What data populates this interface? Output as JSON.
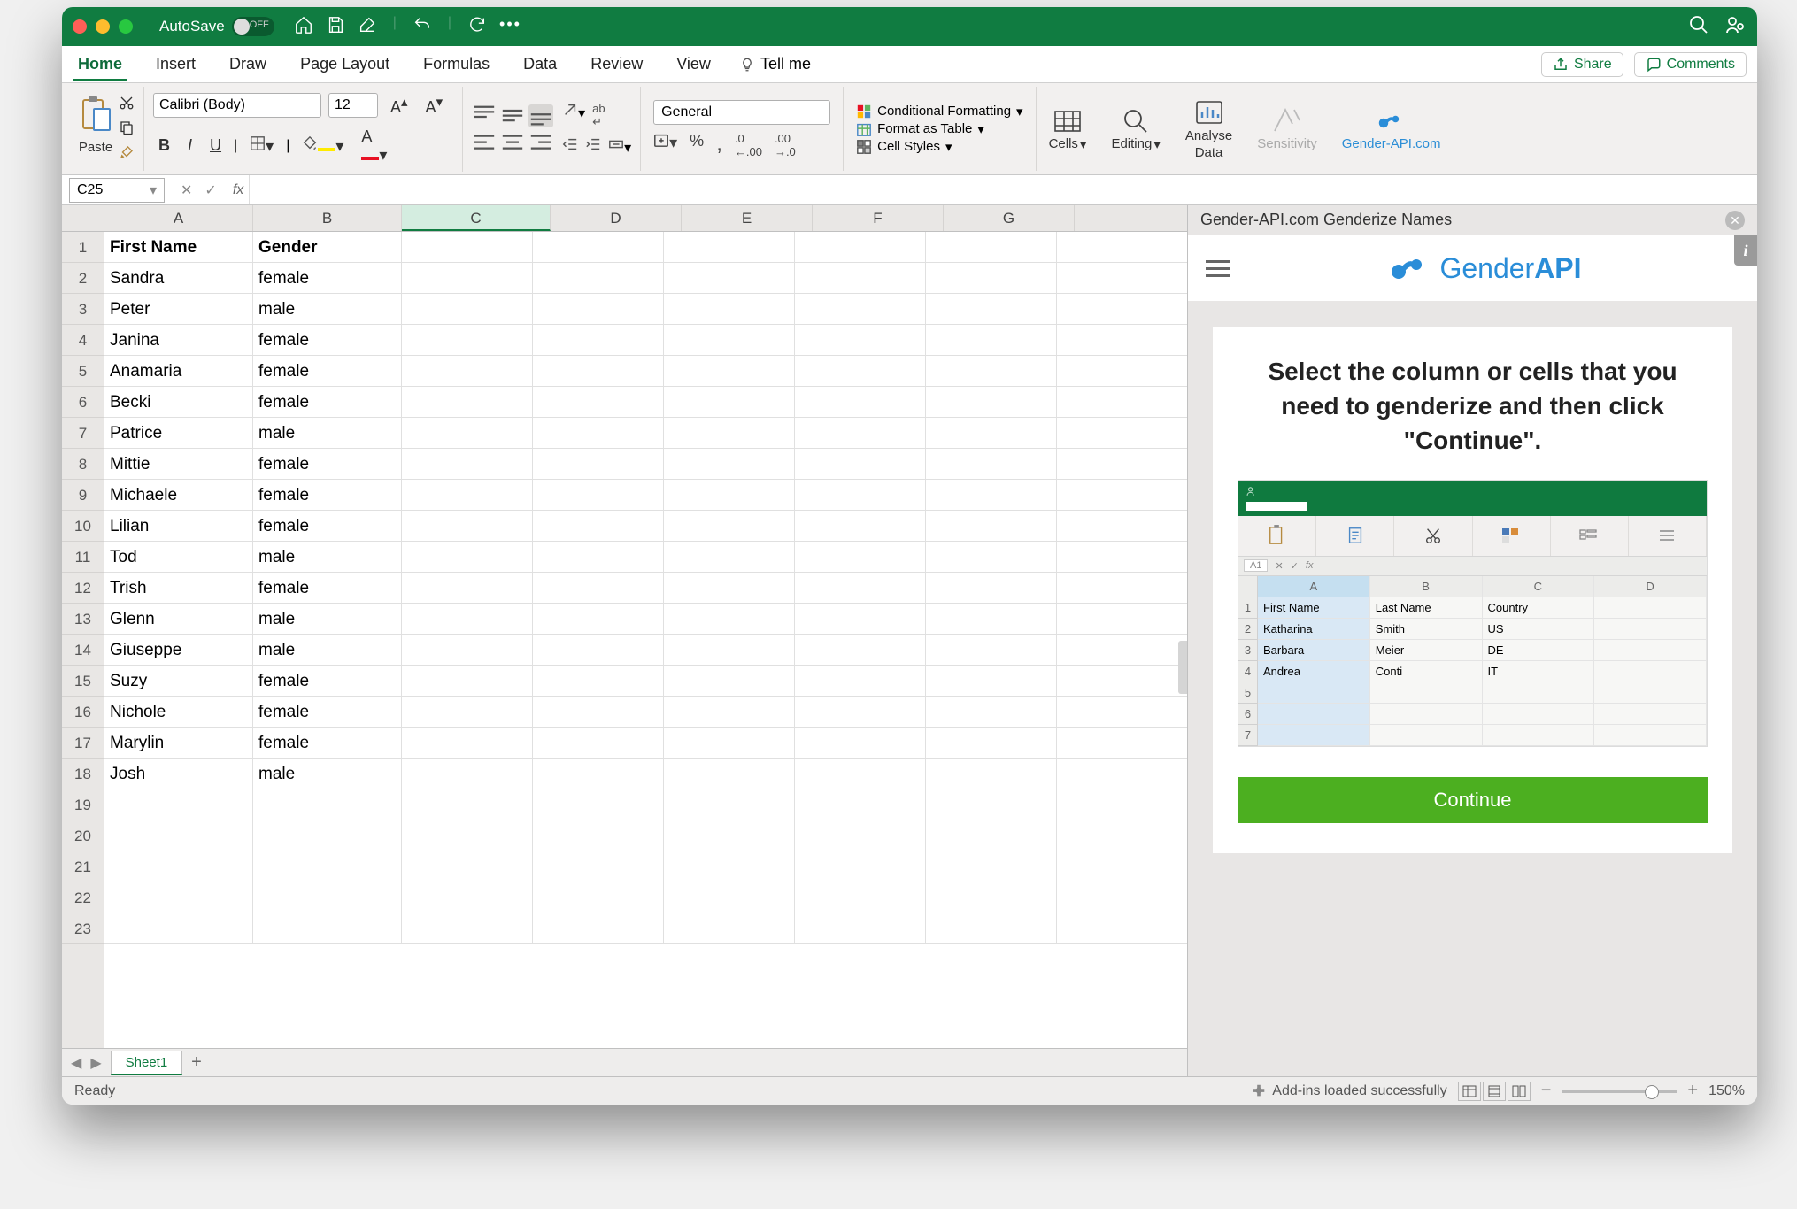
{
  "titlebar": {
    "autosave_label": "AutoSave",
    "autosave_state": "OFF"
  },
  "ribbon": {
    "tabs": [
      "Home",
      "Insert",
      "Draw",
      "Page Layout",
      "Formulas",
      "Data",
      "Review",
      "View"
    ],
    "tellme_label": "Tell me",
    "share_label": "Share",
    "comments_label": "Comments",
    "paste_label": "Paste",
    "font_name": "Calibri (Body)",
    "font_size": "12",
    "number_format": "General",
    "cond_fmt_label": "Conditional Formatting",
    "fmt_table_label": "Format as Table",
    "cell_styles_label": "Cell Styles",
    "cells_label": "Cells",
    "editing_label": "Editing",
    "analyse_label_1": "Analyse",
    "analyse_label_2": "Data",
    "sensitivity_label": "Sensitivity",
    "genderapi_label": "Gender-API.com"
  },
  "namebox": {
    "value": "C25"
  },
  "sheet": {
    "columns": [
      "A",
      "B",
      "C",
      "D",
      "E",
      "F",
      "G"
    ],
    "selected_col": "C",
    "visible_row_count": 23,
    "header_row": [
      "First Name",
      "Gender",
      "",
      "",
      "",
      "",
      ""
    ],
    "data": [
      [
        "Sandra",
        "female"
      ],
      [
        "Peter",
        "male"
      ],
      [
        "Janina",
        "female"
      ],
      [
        "Anamaria",
        "female"
      ],
      [
        "Becki",
        "female"
      ],
      [
        "Patrice",
        "male"
      ],
      [
        "Mittie",
        "female"
      ],
      [
        "Michaele",
        "female"
      ],
      [
        "Lilian",
        "female"
      ],
      [
        "Tod",
        "male"
      ],
      [
        "Trish",
        "female"
      ],
      [
        "Glenn",
        "male"
      ],
      [
        "Giuseppe",
        "male"
      ],
      [
        "Suzy",
        "female"
      ],
      [
        "Nichole",
        "female"
      ],
      [
        "Marylin",
        "female"
      ],
      [
        "Josh",
        "male"
      ]
    ],
    "tab_name": "Sheet1"
  },
  "panel": {
    "title": "Gender-API.com Genderize Names",
    "brand_1": "Gender",
    "brand_2": "API",
    "instruction": "Select the column or cells that you need to genderize and then click \"Continue\".",
    "example_headers": [
      "First Name",
      "Last Name",
      "Country"
    ],
    "example_rows": [
      [
        "Katharina",
        "Smith",
        "US"
      ],
      [
        "Barbara",
        "Meier",
        "DE"
      ],
      [
        "Andrea",
        "Conti",
        "IT"
      ]
    ],
    "example_namebox": "A1",
    "continue_label": "Continue"
  },
  "statusbar": {
    "ready": "Ready",
    "addins_msg": "Add-ins loaded successfully",
    "zoom": "150%"
  }
}
